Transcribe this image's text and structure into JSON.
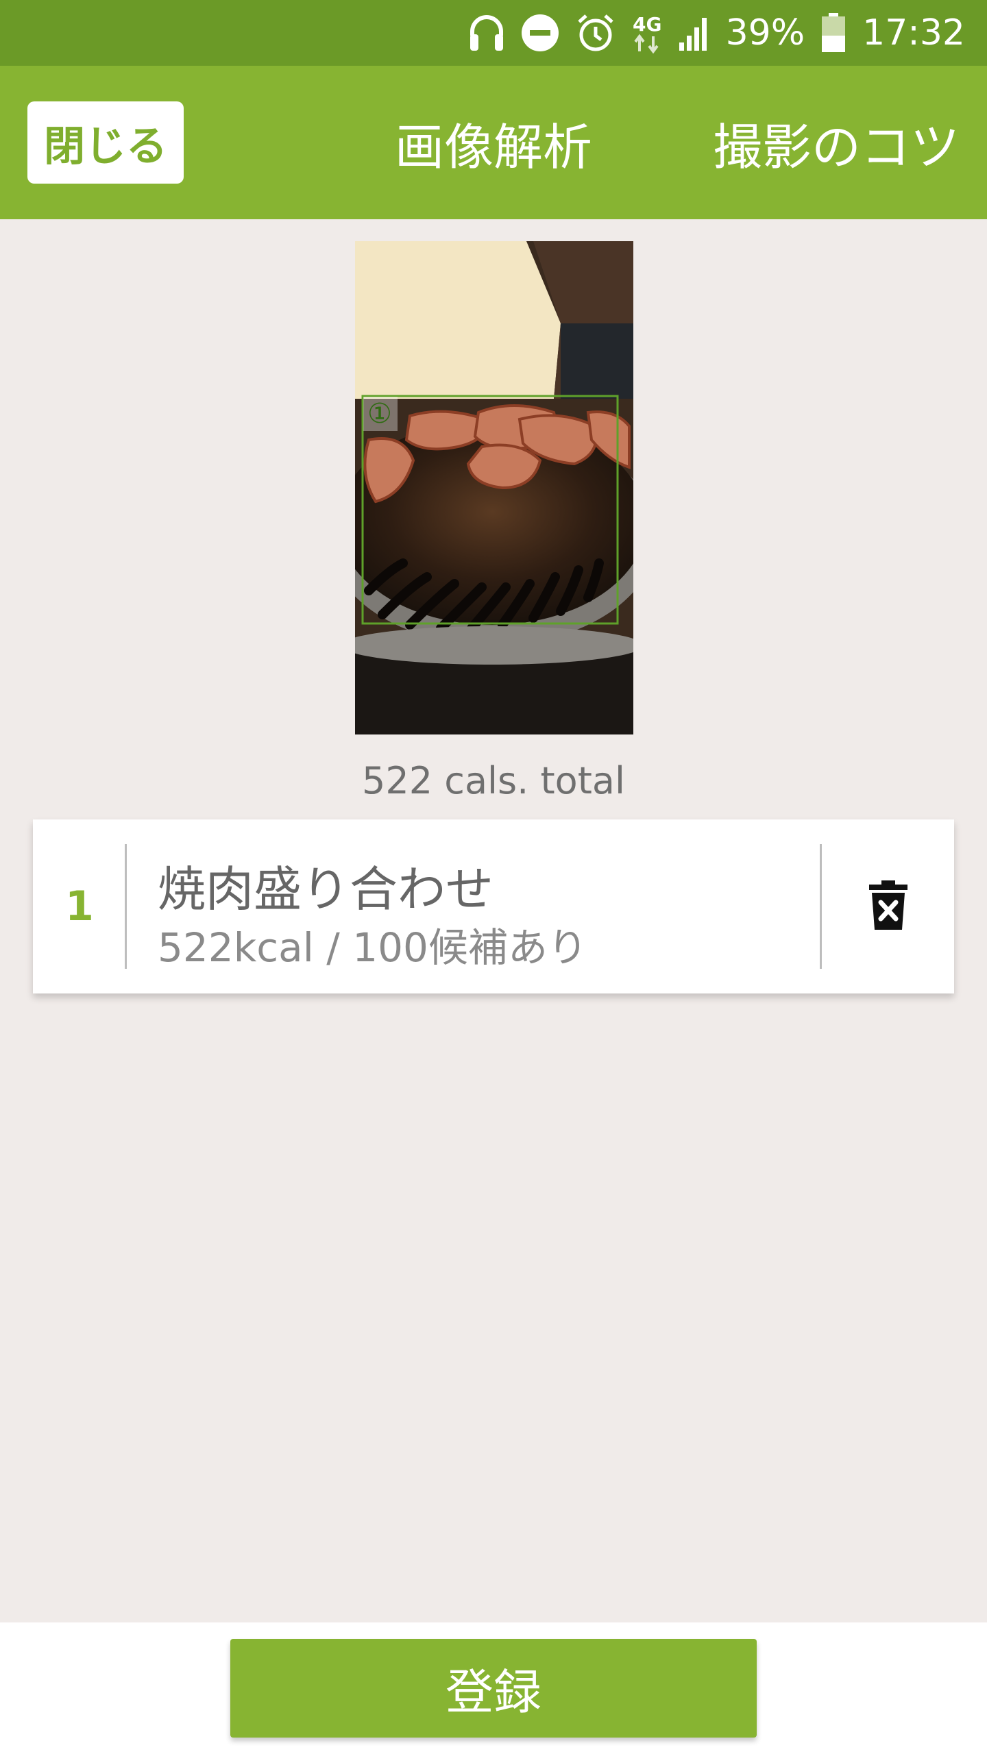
{
  "status_bar": {
    "network": "4G",
    "battery": "39%",
    "time": "17:32"
  },
  "app_bar": {
    "close_label": "閉じる",
    "title": "画像解析",
    "tips_label": "撮影のコツ"
  },
  "photo": {
    "marker": "①"
  },
  "total_label": "522 cals. total",
  "items": [
    {
      "index": "1",
      "name": "焼肉盛り合わせ",
      "detail": "522kcal / 100候補あり"
    }
  ],
  "register_label": "登録",
  "colors": {
    "status_bar": "#6b9a27",
    "app_bar": "#87b432",
    "accent": "#87b432",
    "background": "#f0ebe9"
  },
  "icons": [
    "headphones-icon",
    "dnd-icon",
    "alarm-icon",
    "network-4g-icon",
    "signal-icon",
    "battery-icon",
    "trash-delete-icon"
  ]
}
